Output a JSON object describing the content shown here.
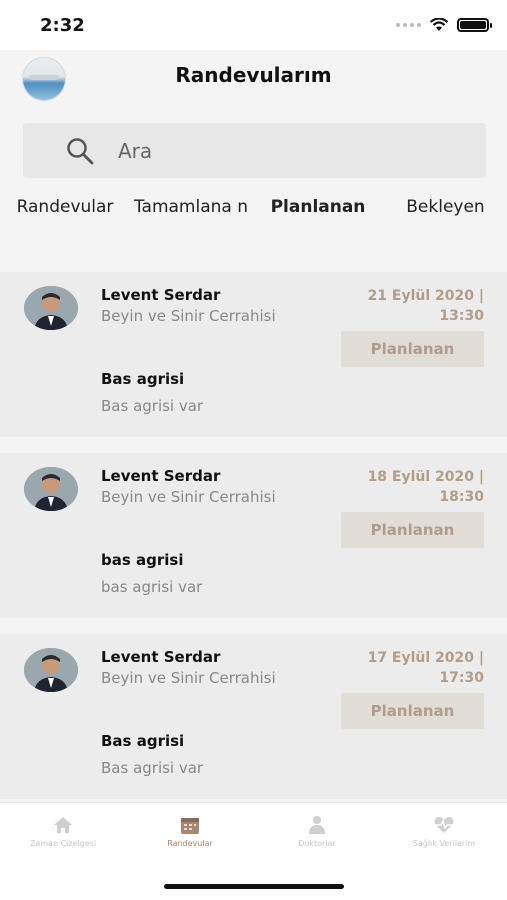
{
  "status_bar": {
    "time": "2:32"
  },
  "header": {
    "title": "Randevularım"
  },
  "search": {
    "placeholder": "Ara"
  },
  "tabs": [
    {
      "label": "Randevular"
    },
    {
      "label": "Tamamlana n"
    },
    {
      "label": "Planlanan"
    },
    {
      "label": "Bekleyen"
    }
  ],
  "appointments": [
    {
      "doctor": "Levent Serdar",
      "specialty": "Beyin ve Sinir Cerrahisi",
      "date": "21 Eylül 2020 |",
      "time": "13:30",
      "status": "Planlanan",
      "complaint": "Bas agrisi",
      "note": "Bas agrisi var"
    },
    {
      "doctor": "Levent Serdar",
      "specialty": "Beyin ve Sinir Cerrahisi",
      "date": "18 Eylül 2020 |",
      "time": "18:30",
      "status": "Planlanan",
      "complaint": "bas agrisi",
      "note": "bas agrisi var"
    },
    {
      "doctor": "Levent Serdar",
      "specialty": "Beyin ve Sinir Cerrahisi",
      "date": "17 Eylül 2020 |",
      "time": "17:30",
      "status": "Planlanan",
      "complaint": "Bas agrisi",
      "note": "Bas agrisi var"
    }
  ],
  "tabbar": [
    {
      "label": "Zaman Çizelgesi",
      "icon": "home-icon"
    },
    {
      "label": "Randevular",
      "icon": "calendar-icon"
    },
    {
      "label": "Doktorlar",
      "icon": "doctor-icon"
    },
    {
      "label": "Sağlık Verilerim",
      "icon": "heart-pulse-icon"
    }
  ],
  "colors": {
    "accent": "#b39d88",
    "status_bg": "#e2dcd6",
    "card_bg": "#ececec"
  }
}
